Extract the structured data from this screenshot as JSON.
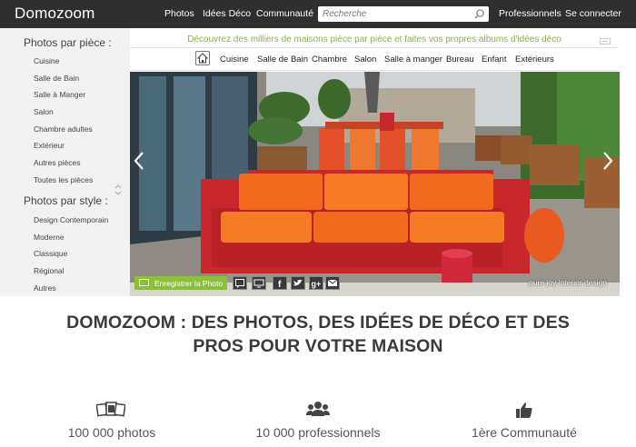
{
  "header": {
    "logo": "Domozoom",
    "nav": [
      "Photos",
      "Idées Déco",
      "Communauté"
    ],
    "search_placeholder": "Recherche",
    "right_nav": [
      "Professionnels",
      "Se connecter"
    ]
  },
  "sidebar": {
    "sections": [
      {
        "title": "Photos par pièce :",
        "items": [
          "Cuisine",
          "Salle de Bain",
          "Salle à Manger",
          "Salon",
          "Chambre adultes",
          "Extérieur",
          "Autres pièces",
          "Toutes les pièces"
        ]
      },
      {
        "title": "Photos par style :",
        "items": [
          "Design Contemporain",
          "Moderne",
          "Classique",
          "Régional",
          "Autres"
        ]
      }
    ]
  },
  "tagline": "Découvrez des milliers de maisons pièce par pièce et faites vos propres albums d'idées déco",
  "categories": [
    "Cuisine",
    "Salle de Bain",
    "Chambre",
    "Salon",
    "Salle à manger",
    "Bureau",
    "Enfant",
    "Extérieurs"
  ],
  "hero": {
    "save_label": "Enregistrer la Photo",
    "credit": "pure joy interior design",
    "social_icons": [
      "comment-icon",
      "screen-icon",
      "facebook-icon",
      "twitter-icon",
      "google-plus-icon",
      "email-icon"
    ]
  },
  "headline": {
    "line1": "DOMOZOOM : DES PHOTOS, DES IDÉES DE DÉCO ET DES",
    "line2": "PROS POUR VOTRE MAISON"
  },
  "stats": [
    {
      "icon": "photos-icon",
      "label": "100 000 photos"
    },
    {
      "icon": "people-icon",
      "label": "10 000 professionnels"
    },
    {
      "icon": "thumbs-up-icon",
      "label": "1ère Communauté"
    }
  ],
  "colors": {
    "topbar": "#2f2f2f",
    "accent_green": "#8bbf3c",
    "tagline_green": "#89b24a",
    "sidebar_bg": "#f2f2f2",
    "sofa_orange": "#f06a1c",
    "sofa_frame_red": "#c8282c"
  }
}
